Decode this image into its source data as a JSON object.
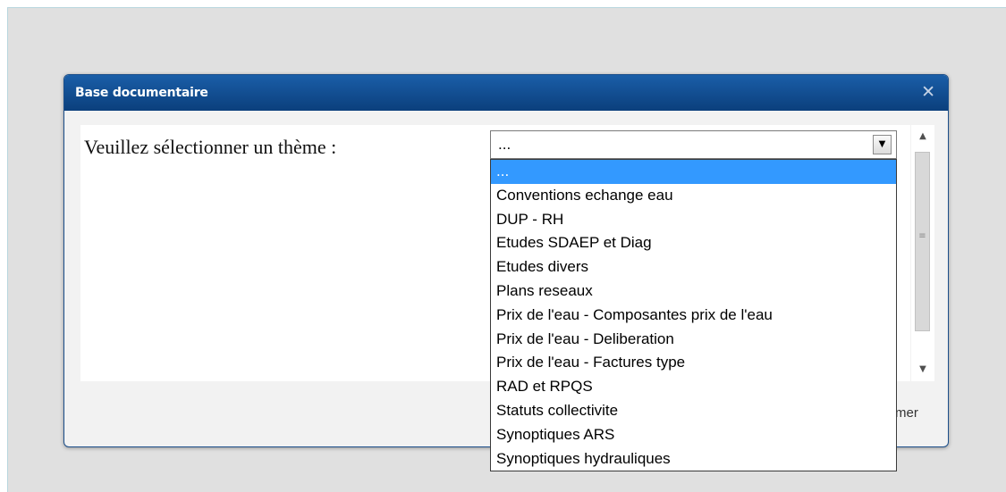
{
  "dialog": {
    "title": "Base documentaire",
    "close_glyph": "✕",
    "prompt": "Veuillez sélectionner un thème :",
    "footer_close_partial": "mer"
  },
  "select": {
    "value": "...",
    "options": [
      "...",
      "Conventions echange eau",
      "DUP - RH",
      "Etudes SDAEP et Diag",
      "Etudes divers",
      "Plans reseaux",
      "Prix de l'eau - Composantes prix de l'eau",
      "Prix de l'eau - Deliberation",
      "Prix de l'eau - Factures type",
      "RAD et RPQS",
      "Statuts collectivite",
      "Synoptiques ARS",
      "Synoptiques hydrauliques"
    ],
    "selected_index": 0
  },
  "icons": {
    "close": "close-icon",
    "dropdown": "chevron-down-icon",
    "scroll_up": "scroll-up-arrow-icon",
    "scroll_down": "scroll-down-arrow-icon"
  },
  "colors": {
    "titlebar": "#0b3f7c",
    "selection": "#3399ff"
  }
}
